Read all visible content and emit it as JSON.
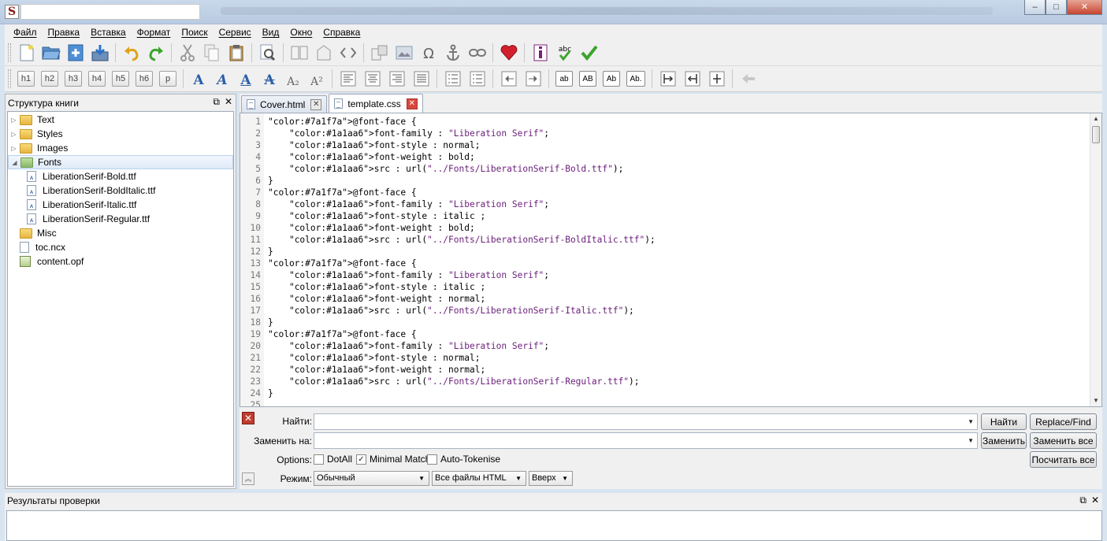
{
  "window": {
    "app_icon_letter": "S",
    "minimize": "–",
    "maximize": "□",
    "close": "✕"
  },
  "menu": [
    "Файл",
    "Правка",
    "Вставка",
    "Формат",
    "Поиск",
    "Сервис",
    "Вид",
    "Окно",
    "Справка"
  ],
  "toolbar_icons": {
    "row1": [
      "new-file-icon",
      "open-folder-icon",
      "add-file-icon",
      "save-icon",
      "undo-icon",
      "redo-icon",
      "cut-icon",
      "copy-icon",
      "paste-icon",
      "find-icon",
      "book-icon",
      "metadata-icon",
      "code-view-icon",
      "split-icon",
      "image-icon",
      "omega-icon",
      "anchor-icon",
      "link-icon",
      "heart-icon",
      "info-icon",
      "spellcheck-icon",
      "check-icon"
    ],
    "heading_buttons": [
      "h1",
      "h2",
      "h3",
      "h4",
      "h5",
      "h6",
      "p"
    ],
    "format_buttons": [
      "A",
      "A",
      "A",
      "A",
      "A₂",
      "A²"
    ],
    "case_buttons": [
      "ab",
      "AB",
      "Ab",
      "Ab."
    ]
  },
  "book_browser": {
    "title": "Структура книги",
    "items": [
      {
        "label": "Text",
        "type": "folder",
        "level": 0
      },
      {
        "label": "Styles",
        "type": "folder",
        "level": 0
      },
      {
        "label": "Images",
        "type": "folder",
        "level": 0
      },
      {
        "label": "Fonts",
        "type": "folder",
        "level": 0,
        "expanded": true,
        "selected": true
      },
      {
        "label": "LiberationSerif-Bold.ttf",
        "type": "font",
        "level": 1
      },
      {
        "label": "LiberationSerif-BoldItalic.ttf",
        "type": "font",
        "level": 1
      },
      {
        "label": "LiberationSerif-Italic.ttf",
        "type": "font",
        "level": 1
      },
      {
        "label": "LiberationSerif-Regular.ttf",
        "type": "font",
        "level": 1
      },
      {
        "label": "Misc",
        "type": "folder",
        "level": 0
      },
      {
        "label": "toc.ncx",
        "type": "file",
        "level": 0
      },
      {
        "label": "content.opf",
        "type": "opf",
        "level": 0
      }
    ]
  },
  "tabs": [
    {
      "label": "Cover.html",
      "active": false
    },
    {
      "label": "template.css",
      "active": true
    }
  ],
  "code_lines": [
    "@font-face {",
    "    font-family : \"Liberation Serif\";",
    "    font-style : normal;",
    "    font-weight : bold;",
    "    src : url(\"../Fonts/LiberationSerif-Bold.ttf\");",
    "}",
    "@font-face {",
    "    font-family : \"Liberation Serif\";",
    "    font-style : italic ;",
    "    font-weight : bold;",
    "    src : url(\"../Fonts/LiberationSerif-BoldItalic.ttf\");",
    "}",
    "@font-face {",
    "    font-family : \"Liberation Serif\";",
    "    font-style : italic ;",
    "    font-weight : normal;",
    "    src : url(\"../Fonts/LiberationSerif-Italic.ttf\");",
    "}",
    "@font-face {",
    "    font-family : \"Liberation Serif\";",
    "    font-style : normal;",
    "    font-weight : normal;",
    "    src : url(\"../Fonts/LiberationSerif-Regular.ttf\");",
    "}",
    ""
  ],
  "find_replace": {
    "find_label": "Найти:",
    "find_value": "",
    "replace_label": "Заменить на:",
    "replace_value": "",
    "options_label": "Options:",
    "options": [
      {
        "label": "DotAll",
        "checked": false
      },
      {
        "label": "Minimal Match",
        "checked": true
      },
      {
        "label": "Auto-Tokenise",
        "checked": false
      }
    ],
    "mode_label": "Режим:",
    "mode_value": "Обычный",
    "scope_value": "Все файлы HTML",
    "direction_value": "Вверх",
    "buttons": {
      "find": "Найти",
      "replace_find": "Replace/Find",
      "replace": "Заменить",
      "replace_all": "Заменить все",
      "count_all": "Посчитать все"
    }
  },
  "validation": {
    "title": "Результаты проверки"
  },
  "colors": {
    "at_rule": "#7a1f7a",
    "property": "#1a1aa6",
    "string": "#6a1e7a"
  }
}
